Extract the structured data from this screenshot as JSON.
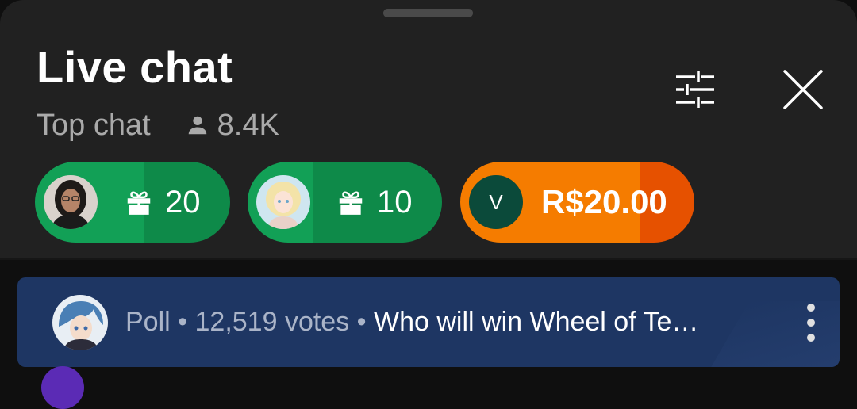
{
  "header": {
    "title": "Live chat",
    "mode": "Top chat",
    "viewer_count": "8.4K"
  },
  "pills": [
    {
      "type": "gift",
      "count": "20",
      "color": "#12a056",
      "progress": 0.56
    },
    {
      "type": "gift",
      "count": "10",
      "color": "#12a056",
      "progress": 0.33
    },
    {
      "type": "super-chat",
      "avatar_letter": "V",
      "amount": "R$20.00",
      "color": "#f57c00",
      "progress": 0.77
    }
  ],
  "poll": {
    "label": "Poll",
    "votes": "12,519 votes",
    "question": "Who will win Wheel of Te…",
    "bg_color": "#1e3663"
  },
  "icons": {
    "filter": "tune-icon",
    "close": "close-icon",
    "viewer": "person-icon",
    "gift": "gift-icon",
    "more": "more-vert-icon"
  }
}
